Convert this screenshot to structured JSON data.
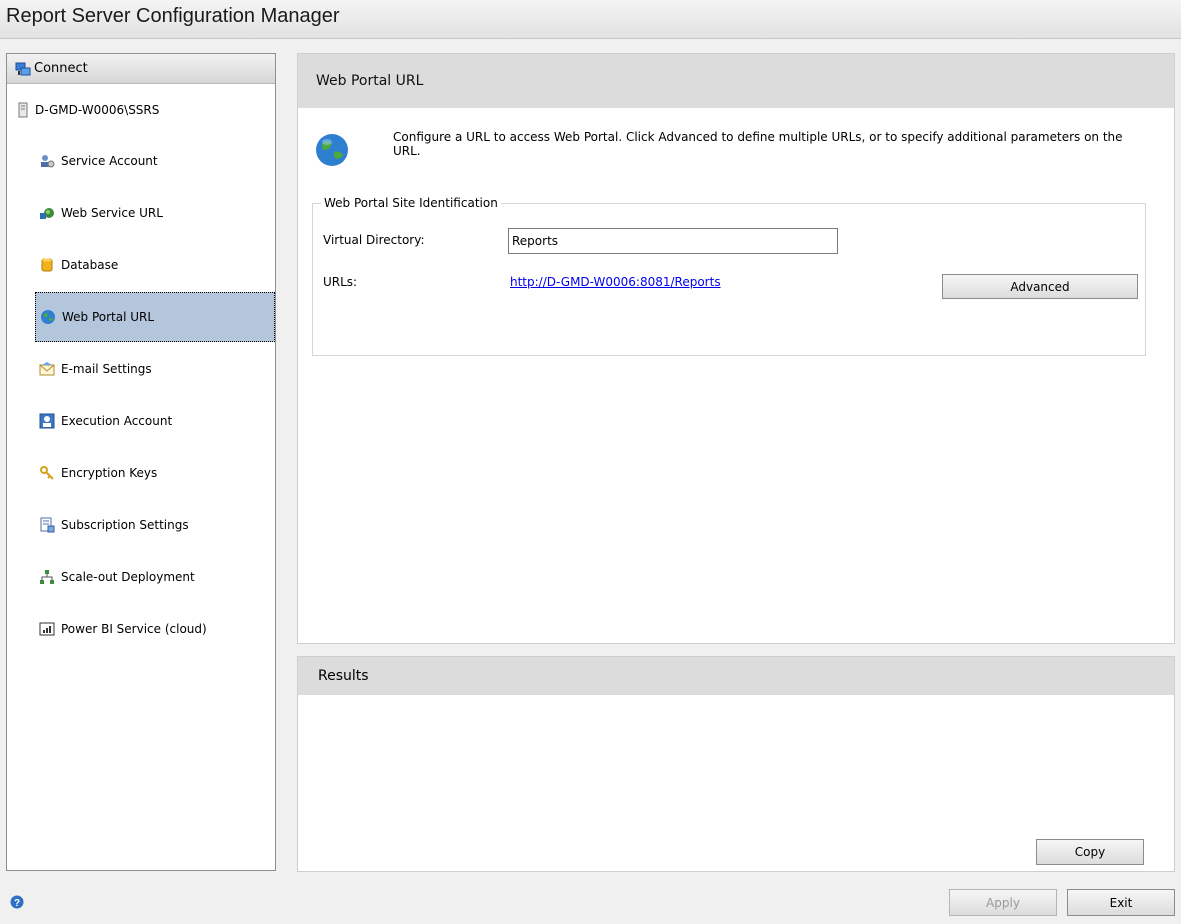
{
  "app": {
    "title": "Report Server Configuration Manager"
  },
  "nav": {
    "connect_label": "Connect",
    "server_name": "D-GMD-W0006\\SSRS",
    "items": [
      {
        "label": "Service Account",
        "icon": "service-account-icon"
      },
      {
        "label": "Web Service URL",
        "icon": "web-service-icon"
      },
      {
        "label": "Database",
        "icon": "database-icon"
      },
      {
        "label": "Web Portal URL",
        "icon": "globe-icon",
        "selected": true
      },
      {
        "label": "E-mail Settings",
        "icon": "email-icon"
      },
      {
        "label": "Execution Account",
        "icon": "user-icon"
      },
      {
        "label": "Encryption Keys",
        "icon": "keys-icon"
      },
      {
        "label": "Subscription Settings",
        "icon": "subscription-icon"
      },
      {
        "label": "Scale-out Deployment",
        "icon": "scaleout-icon"
      },
      {
        "label": "Power BI Service (cloud)",
        "icon": "powerbi-icon"
      }
    ]
  },
  "main": {
    "header": "Web Portal URL",
    "intro": "Configure a URL to access Web Portal.  Click Advanced to define multiple URLs, or to specify additional parameters on the URL.",
    "group_title": "Web Portal Site Identification",
    "virtual_directory_label": "Virtual Directory:",
    "virtual_directory_value": "Reports",
    "urls_label": "URLs:",
    "url_link": "http://D-GMD-W0006:8081/Reports",
    "advanced_label": "Advanced"
  },
  "results": {
    "header": "Results",
    "copy_label": "Copy"
  },
  "footer": {
    "apply_label": "Apply",
    "exit_label": "Exit"
  },
  "colors": {
    "selected_bg": "#b4c6dc",
    "link": "#0000ee",
    "header_bg": "#dcdcdc"
  }
}
